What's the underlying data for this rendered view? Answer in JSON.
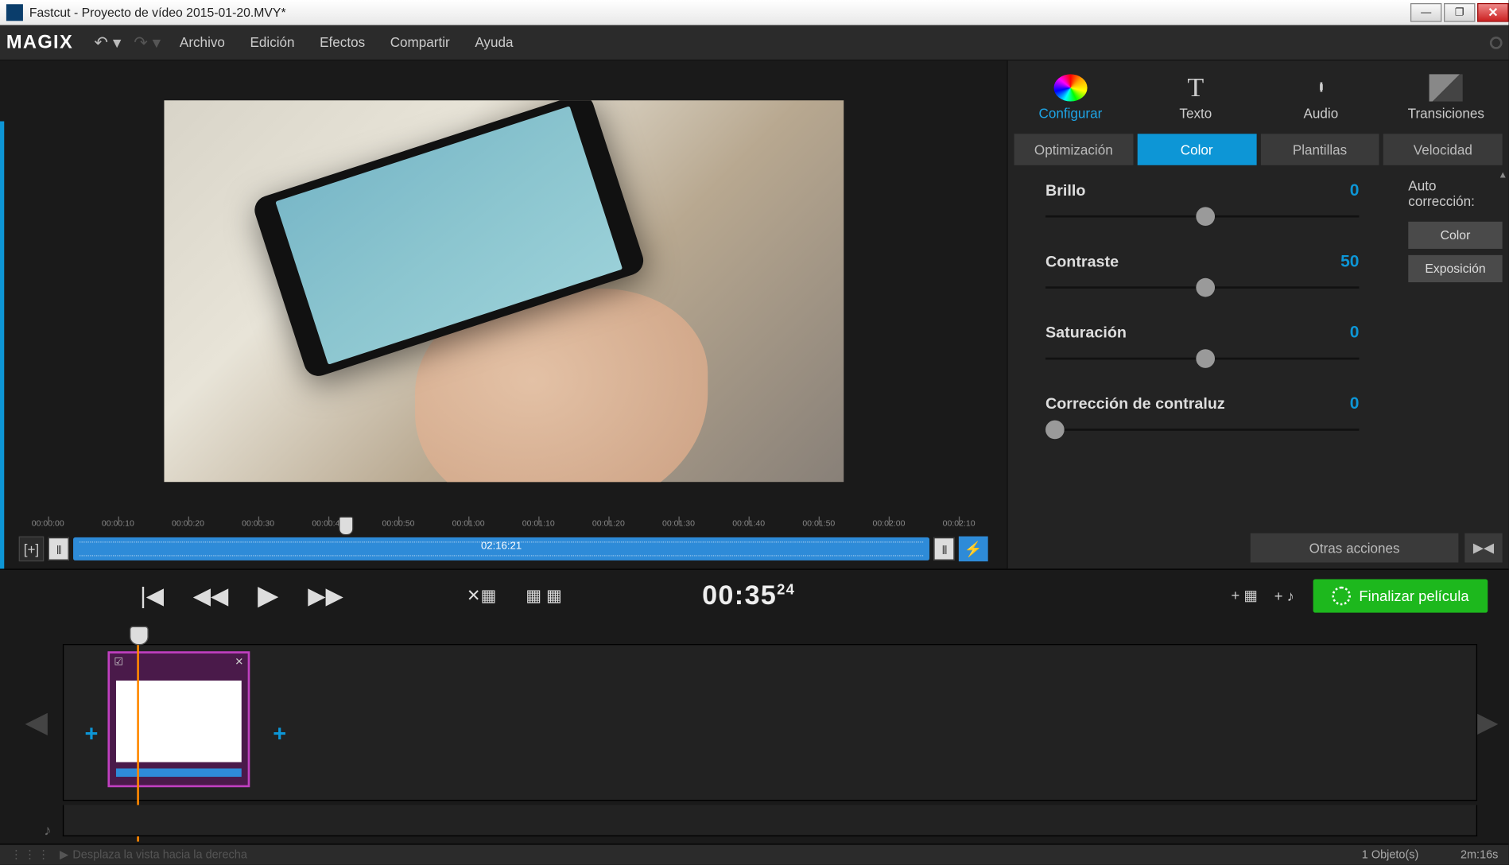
{
  "window": {
    "title": "Fastcut - Proyecto de vídeo 2015-01-20.MVY*"
  },
  "brand": "MAGIX",
  "menu": {
    "items": [
      "Archivo",
      "Edición",
      "Efectos",
      "Compartir",
      "Ayuda"
    ]
  },
  "toptabs": [
    {
      "label": "Configurar",
      "active": true
    },
    {
      "label": "Texto",
      "active": false
    },
    {
      "label": "Audio",
      "active": false
    },
    {
      "label": "Transiciones",
      "active": false
    }
  ],
  "subtabs": [
    {
      "label": "Optimización",
      "active": false
    },
    {
      "label": "Color",
      "active": true
    },
    {
      "label": "Plantillas",
      "active": false
    },
    {
      "label": "Velocidad",
      "active": false
    }
  ],
  "sliders": {
    "brillo": {
      "label": "Brillo",
      "value": 0,
      "pos": 48
    },
    "contraste": {
      "label": "Contraste",
      "value": 50,
      "pos": 48
    },
    "saturacion": {
      "label": "Saturación",
      "value": 0,
      "pos": 48
    },
    "contraluz": {
      "label": "Corrección de contraluz",
      "value": 0,
      "pos": 0
    }
  },
  "autocorr": {
    "label": "Auto corrección:",
    "btn_color": "Color",
    "btn_expo": "Exposición"
  },
  "actions": {
    "otras": "Otras acciones",
    "finalize": "Finalizar película"
  },
  "ruler": {
    "ticks": [
      "00:00:00",
      "00:00:10",
      "00:00:20",
      "00:00:30",
      "00:00:40",
      "00:00:50",
      "00:01:00",
      "00:01:10",
      "00:01:20",
      "00:01:30",
      "00:01:40",
      "00:01:50",
      "00:02:00",
      "00:02:10"
    ],
    "clip_duration": "02:16:21"
  },
  "timecode": {
    "main": "00:35",
    "frames": "24"
  },
  "status": {
    "hint": "Desplaza la vista hacia la derecha",
    "objects": "1 Objeto(s)",
    "duration": "2m:16s"
  }
}
